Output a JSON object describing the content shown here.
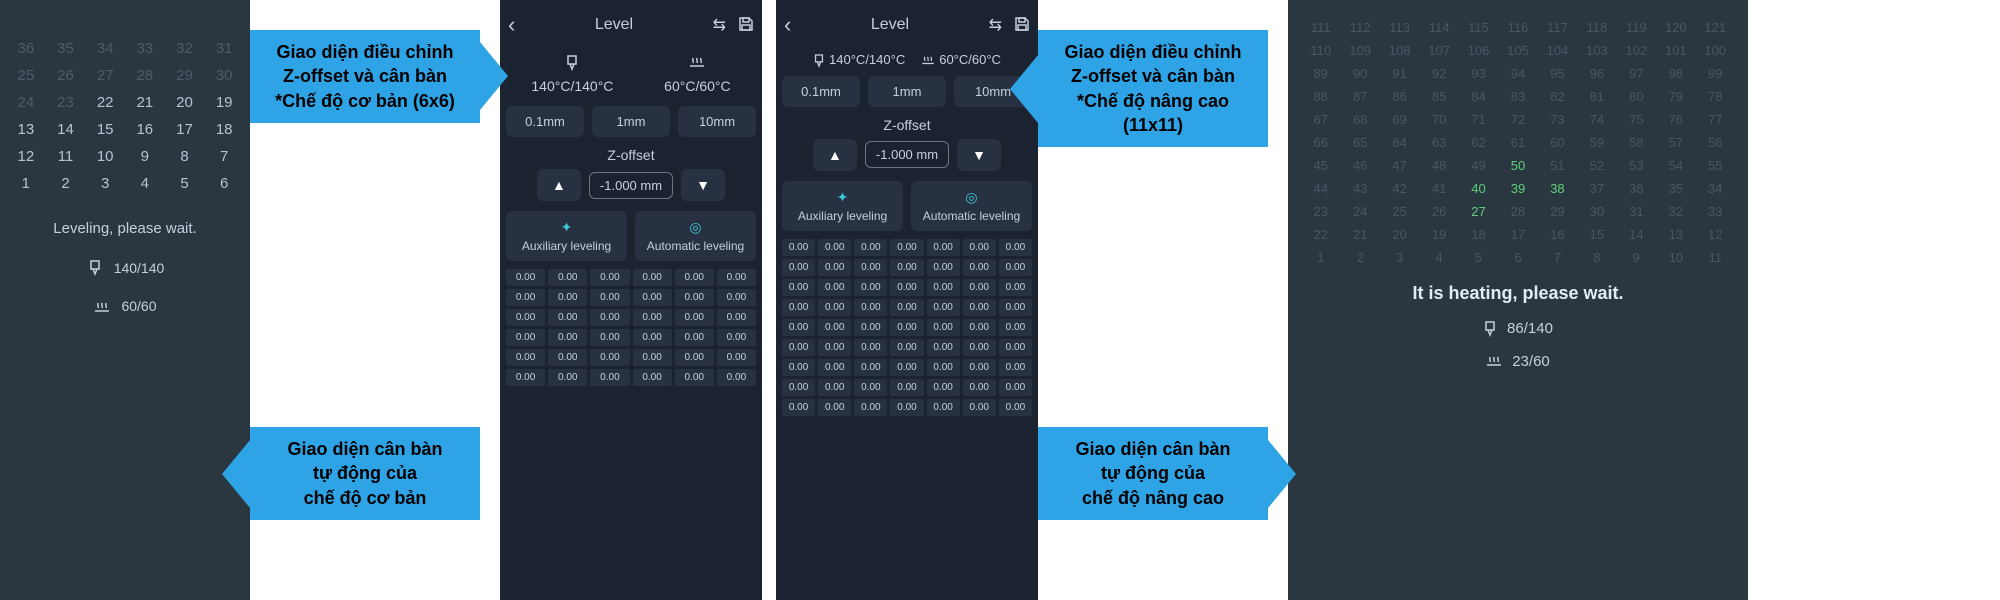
{
  "panelA": {
    "grid": [
      {
        "n": 36,
        "done": false
      },
      {
        "n": 35,
        "done": false
      },
      {
        "n": 34,
        "done": false
      },
      {
        "n": 33,
        "done": false
      },
      {
        "n": 32,
        "done": false
      },
      {
        "n": 31,
        "done": false
      },
      {
        "n": 25,
        "done": false
      },
      {
        "n": 26,
        "done": false
      },
      {
        "n": 27,
        "done": false
      },
      {
        "n": 28,
        "done": false
      },
      {
        "n": 29,
        "done": false
      },
      {
        "n": 30,
        "done": false
      },
      {
        "n": 24,
        "done": false
      },
      {
        "n": 23,
        "done": false
      },
      {
        "n": 22,
        "done": true
      },
      {
        "n": 21,
        "done": true
      },
      {
        "n": 20,
        "done": true
      },
      {
        "n": 19,
        "done": true
      },
      {
        "n": 13,
        "done": true
      },
      {
        "n": 14,
        "done": true
      },
      {
        "n": 15,
        "done": true
      },
      {
        "n": 16,
        "done": true
      },
      {
        "n": 17,
        "done": true
      },
      {
        "n": 18,
        "done": true
      },
      {
        "n": 12,
        "done": true
      },
      {
        "n": 11,
        "done": true
      },
      {
        "n": 10,
        "done": true
      },
      {
        "n": 9,
        "done": true
      },
      {
        "n": 8,
        "done": true
      },
      {
        "n": 7,
        "done": true
      },
      {
        "n": 1,
        "done": true
      },
      {
        "n": 2,
        "done": true
      },
      {
        "n": 3,
        "done": true
      },
      {
        "n": 4,
        "done": true
      },
      {
        "n": 5,
        "done": true
      },
      {
        "n": 6,
        "done": true
      }
    ],
    "status": "Leveling, please wait.",
    "nozzle": "140/140",
    "bed": "60/60"
  },
  "calloutsLeft": {
    "top_line1": "Giao diện điều chỉnh",
    "top_line2": "Z-offset và cân bàn",
    "top_line3": "*Chế độ cơ bản (6x6)",
    "bottom_line1": "Giao diện cân bàn",
    "bottom_line2": "tự động của",
    "bottom_line3": "chế độ cơ bản"
  },
  "phone1": {
    "title": "Level",
    "nozzle": "140°C/140°C",
    "bed": "60°C/60°C",
    "steps": [
      "0.1mm",
      "1mm",
      "10mm"
    ],
    "z_label": "Z-offset",
    "z_value": "-1.000 mm",
    "aux": "Auxiliary leveling",
    "auto": "Automatic leveling",
    "mesh_cols": 6,
    "mesh_rows": 6,
    "mesh_val": "0.00"
  },
  "phone2": {
    "title": "Level",
    "nozzle": "140°C/140°C",
    "bed": "60°C/60°C",
    "steps": [
      "0.1mm",
      "1mm",
      "10mm"
    ],
    "z_label": "Z-offset",
    "z_value": "-1.000 mm",
    "aux": "Auxiliary leveling",
    "auto": "Automatic leveling",
    "mesh_cols": 7,
    "mesh_rows": 9,
    "mesh_val": "0.00"
  },
  "calloutsRight": {
    "top_line1": "Giao diện điều chỉnh",
    "top_line2": "Z-offset và cân bàn",
    "top_line3": "*Chế độ nâng cao",
    "top_line4": "(11x11)",
    "bottom_line1": "Giao diện cân bàn",
    "bottom_line2": "tự động của",
    "bottom_line3": "chế độ nâng cao"
  },
  "panelF": {
    "grid_rows": [
      [
        111,
        112,
        113,
        114,
        115,
        116,
        117,
        118,
        119,
        120,
        121
      ],
      [
        110,
        109,
        108,
        107,
        106,
        105,
        104,
        103,
        102,
        101,
        100
      ],
      [
        89,
        90,
        91,
        92,
        93,
        94,
        95,
        96,
        97,
        98,
        99
      ],
      [
        88,
        87,
        86,
        85,
        84,
        83,
        82,
        81,
        80,
        79,
        78
      ],
      [
        67,
        68,
        69,
        70,
        71,
        72,
        73,
        74,
        75,
        76,
        77
      ],
      [
        66,
        65,
        64,
        63,
        62,
        61,
        60,
        59,
        58,
        57,
        56
      ],
      [
        45,
        46,
        47,
        48,
        49,
        50,
        51,
        52,
        53,
        54,
        55
      ],
      [
        44,
        43,
        42,
        41,
        40,
        39,
        38,
        37,
        36,
        35,
        34
      ],
      [
        23,
        24,
        25,
        26,
        27,
        28,
        29,
        30,
        31,
        32,
        33
      ],
      [
        22,
        21,
        20,
        19,
        18,
        17,
        16,
        15,
        14,
        13,
        12
      ],
      [
        1,
        2,
        3,
        4,
        5,
        6,
        7,
        8,
        9,
        10,
        11
      ]
    ],
    "highlight_cells": [
      27,
      38,
      39,
      40,
      50
    ],
    "status": "It is heating, please wait.",
    "nozzle": "86/140",
    "bed": "23/60"
  }
}
